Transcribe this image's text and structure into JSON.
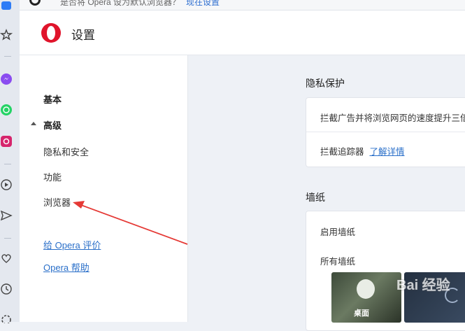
{
  "topbar": {
    "message": "是否将 Opera 设为默认浏览器？",
    "link": "现在设置"
  },
  "header": {
    "title": "设置"
  },
  "sidebar": {
    "basic": "基本",
    "advanced": "高级",
    "items": [
      "隐私和安全",
      "功能",
      "浏览器"
    ],
    "links": [
      "给 Opera 评价",
      "Opera 帮助"
    ]
  },
  "main": {
    "privacy": {
      "title": "隐私保护",
      "block_ads": "拦截广告并将浏览网页的速度提升三倍",
      "block_trackers": "拦截追踪器",
      "learn_more": "了解详情"
    },
    "wallpaper": {
      "title": "墙纸",
      "enable": "启用墙纸",
      "all": "所有墙纸",
      "thumb_label": "桌面"
    }
  },
  "watermark": "Bai 经验",
  "colors": {
    "accent": "#2a6fc9",
    "opera_red": "#e0142b",
    "annotation_arrow": "#e53935"
  }
}
